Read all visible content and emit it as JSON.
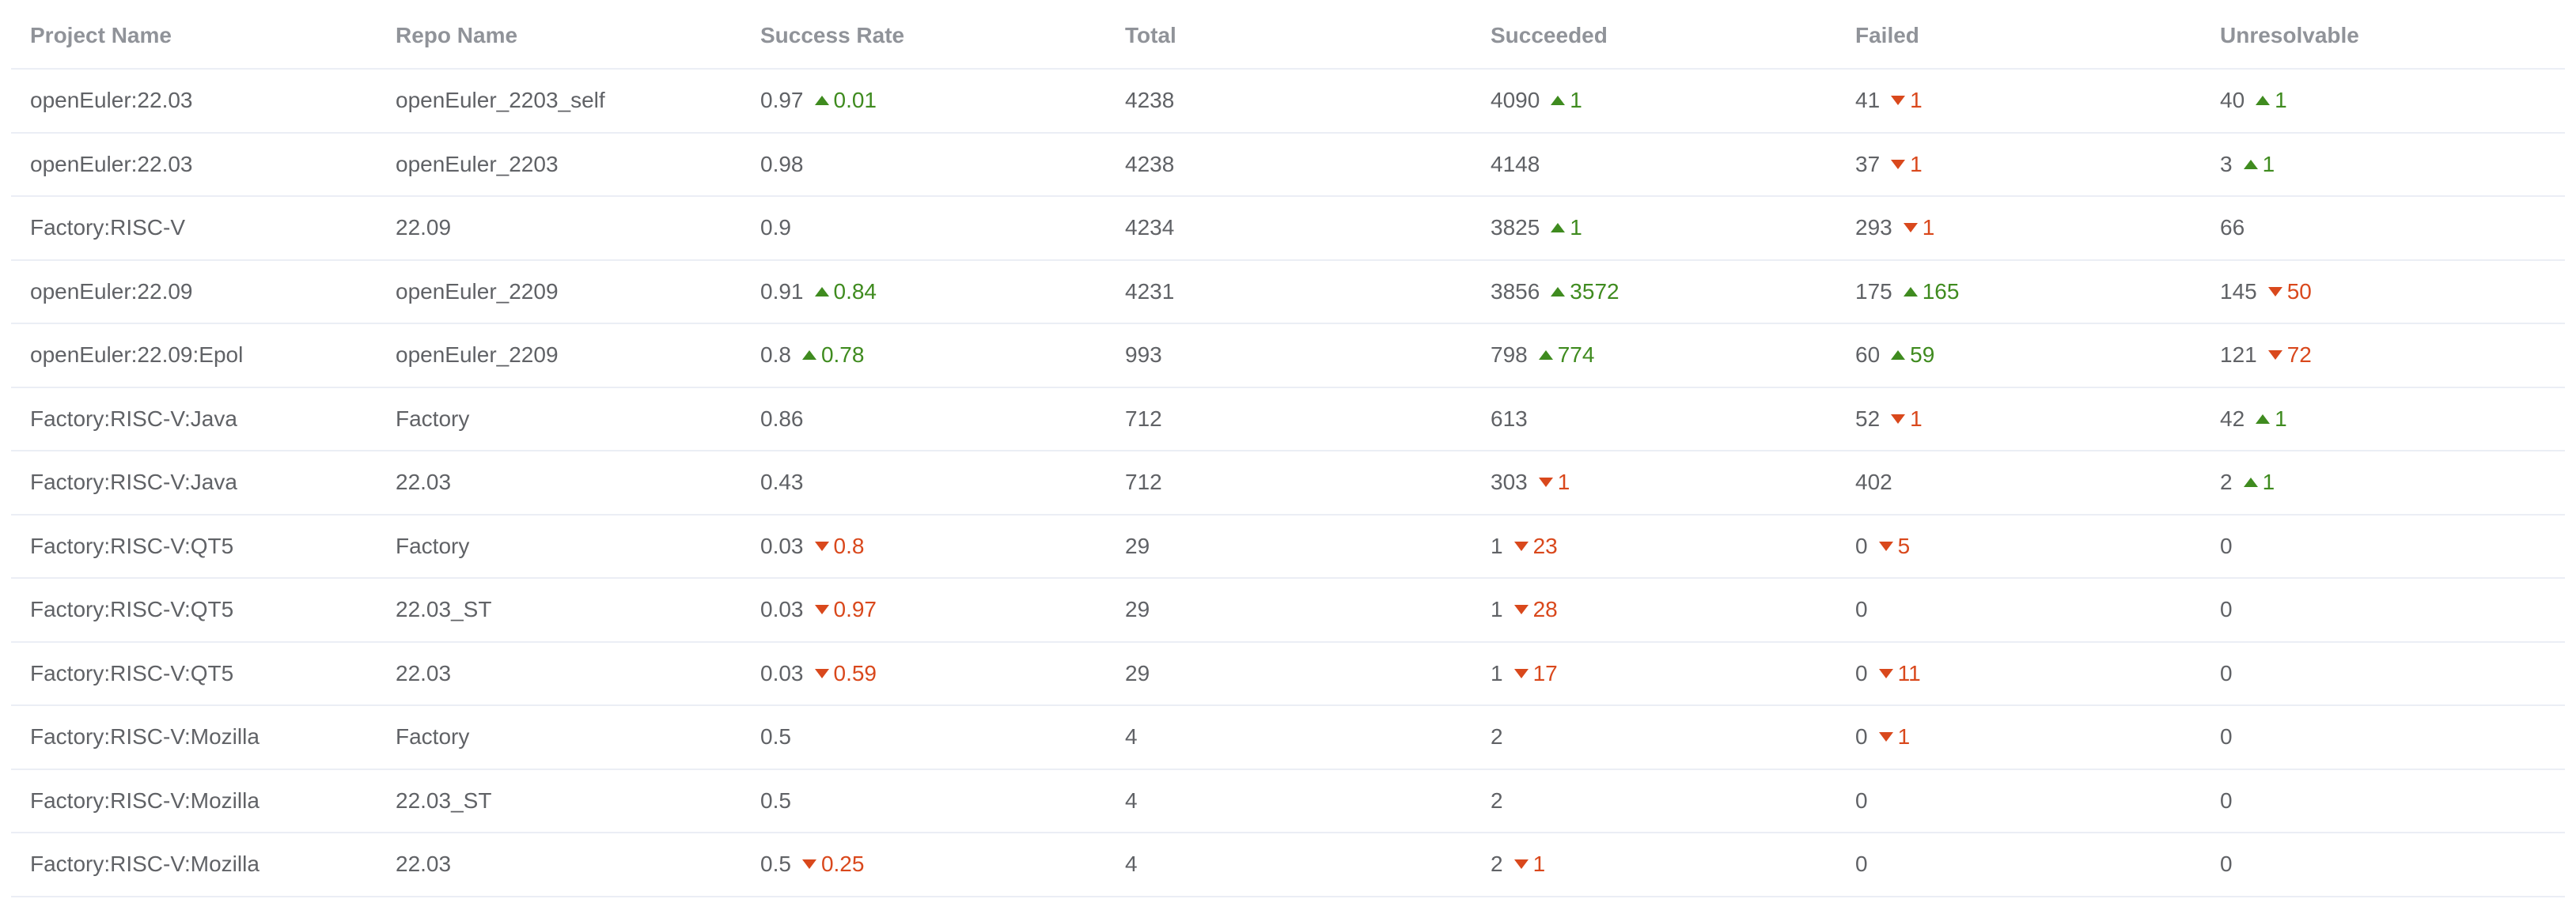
{
  "colors": {
    "up": "#3f8b1f",
    "down": "#d9481c",
    "text": "#606266",
    "header": "#909399",
    "border": "#ebeef5"
  },
  "headers": [
    "Project Name",
    "Repo Name",
    "Success Rate",
    "Total",
    "Succeeded",
    "Failed",
    "Unresolvable"
  ],
  "rows": [
    {
      "project": "openEuler:22.03",
      "repo": "openEuler_2203_self",
      "success_rate": {
        "value": "0.97",
        "dir": "up",
        "delta": "0.01"
      },
      "total": {
        "value": "4238"
      },
      "succeeded": {
        "value": "4090",
        "dir": "up",
        "delta": "1"
      },
      "failed": {
        "value": "41",
        "dir": "down",
        "delta": "1"
      },
      "unresolvable": {
        "value": "40",
        "dir": "up",
        "delta": "1"
      }
    },
    {
      "project": "openEuler:22.03",
      "repo": "openEuler_2203",
      "success_rate": {
        "value": "0.98"
      },
      "total": {
        "value": "4238"
      },
      "succeeded": {
        "value": "4148"
      },
      "failed": {
        "value": "37",
        "dir": "down",
        "delta": "1"
      },
      "unresolvable": {
        "value": "3",
        "dir": "up",
        "delta": "1"
      }
    },
    {
      "project": "Factory:RISC-V",
      "repo": "22.09",
      "success_rate": {
        "value": "0.9"
      },
      "total": {
        "value": "4234"
      },
      "succeeded": {
        "value": "3825",
        "dir": "up",
        "delta": "1"
      },
      "failed": {
        "value": "293",
        "dir": "down",
        "delta": "1"
      },
      "unresolvable": {
        "value": "66"
      }
    },
    {
      "project": "openEuler:22.09",
      "repo": "openEuler_2209",
      "success_rate": {
        "value": "0.91",
        "dir": "up",
        "delta": "0.84"
      },
      "total": {
        "value": "4231"
      },
      "succeeded": {
        "value": "3856",
        "dir": "up",
        "delta": "3572"
      },
      "failed": {
        "value": "175",
        "dir": "up",
        "delta": "165"
      },
      "unresolvable": {
        "value": "145",
        "dir": "down",
        "delta": "50"
      }
    },
    {
      "project": "openEuler:22.09:Epol",
      "repo": "openEuler_2209",
      "success_rate": {
        "value": "0.8",
        "dir": "up",
        "delta": "0.78"
      },
      "total": {
        "value": "993"
      },
      "succeeded": {
        "value": "798",
        "dir": "up",
        "delta": "774"
      },
      "failed": {
        "value": "60",
        "dir": "up",
        "delta": "59"
      },
      "unresolvable": {
        "value": "121",
        "dir": "down",
        "delta": "72"
      }
    },
    {
      "project": "Factory:RISC-V:Java",
      "repo": "Factory",
      "success_rate": {
        "value": "0.86"
      },
      "total": {
        "value": "712"
      },
      "succeeded": {
        "value": "613"
      },
      "failed": {
        "value": "52",
        "dir": "down",
        "delta": "1"
      },
      "unresolvable": {
        "value": "42",
        "dir": "up",
        "delta": "1"
      }
    },
    {
      "project": "Factory:RISC-V:Java",
      "repo": "22.03",
      "success_rate": {
        "value": "0.43"
      },
      "total": {
        "value": "712"
      },
      "succeeded": {
        "value": "303",
        "dir": "down",
        "delta": "1"
      },
      "failed": {
        "value": "402"
      },
      "unresolvable": {
        "value": "2",
        "dir": "up",
        "delta": "1"
      }
    },
    {
      "project": "Factory:RISC-V:QT5",
      "repo": "Factory",
      "success_rate": {
        "value": "0.03",
        "dir": "down",
        "delta": "0.8"
      },
      "total": {
        "value": "29"
      },
      "succeeded": {
        "value": "1",
        "dir": "down",
        "delta": "23"
      },
      "failed": {
        "value": "0",
        "dir": "down",
        "delta": "5"
      },
      "unresolvable": {
        "value": "0"
      }
    },
    {
      "project": "Factory:RISC-V:QT5",
      "repo": "22.03_ST",
      "success_rate": {
        "value": "0.03",
        "dir": "down",
        "delta": "0.97"
      },
      "total": {
        "value": "29"
      },
      "succeeded": {
        "value": "1",
        "dir": "down",
        "delta": "28"
      },
      "failed": {
        "value": "0"
      },
      "unresolvable": {
        "value": "0"
      }
    },
    {
      "project": "Factory:RISC-V:QT5",
      "repo": "22.03",
      "success_rate": {
        "value": "0.03",
        "dir": "down",
        "delta": "0.59"
      },
      "total": {
        "value": "29"
      },
      "succeeded": {
        "value": "1",
        "dir": "down",
        "delta": "17"
      },
      "failed": {
        "value": "0",
        "dir": "down",
        "delta": "11"
      },
      "unresolvable": {
        "value": "0"
      }
    },
    {
      "project": "Factory:RISC-V:Mozilla",
      "repo": "Factory",
      "success_rate": {
        "value": "0.5"
      },
      "total": {
        "value": "4"
      },
      "succeeded": {
        "value": "2"
      },
      "failed": {
        "value": "0",
        "dir": "down",
        "delta": "1"
      },
      "unresolvable": {
        "value": "0"
      }
    },
    {
      "project": "Factory:RISC-V:Mozilla",
      "repo": "22.03_ST",
      "success_rate": {
        "value": "0.5"
      },
      "total": {
        "value": "4"
      },
      "succeeded": {
        "value": "2"
      },
      "failed": {
        "value": "0"
      },
      "unresolvable": {
        "value": "0"
      }
    },
    {
      "project": "Factory:RISC-V:Mozilla",
      "repo": "22.03",
      "success_rate": {
        "value": "0.5",
        "dir": "down",
        "delta": "0.25"
      },
      "total": {
        "value": "4"
      },
      "succeeded": {
        "value": "2",
        "dir": "down",
        "delta": "1"
      },
      "failed": {
        "value": "0"
      },
      "unresolvable": {
        "value": "0"
      }
    }
  ]
}
